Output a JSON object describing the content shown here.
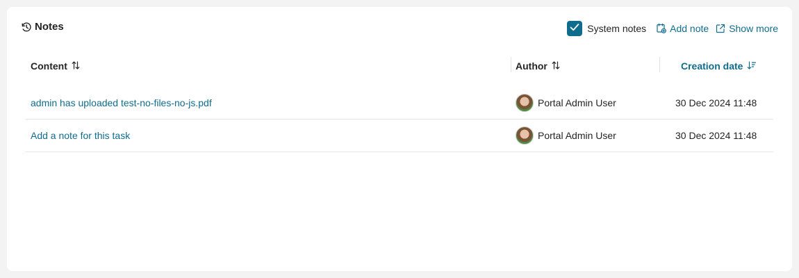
{
  "header": {
    "title": "Notes",
    "system_notes_label": "System notes",
    "system_notes_checked": true,
    "add_note_label": "Add note",
    "show_more_label": "Show more"
  },
  "table": {
    "columns": {
      "content": "Content",
      "author": "Author",
      "creation_date": "Creation date"
    },
    "sorted_by": "Creation date",
    "rows": [
      {
        "content": "admin has uploaded test-no-files-no-js.pdf",
        "author": "Portal Admin User",
        "date": "30 Dec 2024 11:48"
      },
      {
        "content": "Add a note for this task",
        "author": "Portal Admin User",
        "date": "30 Dec 2024 11:48"
      }
    ]
  },
  "colors": {
    "accent": "#0f6c8d",
    "text": "#242424",
    "background": "#f3f3f3",
    "card": "#ffffff"
  },
  "icons": {
    "title": "history-icon",
    "add_note": "note-add-icon",
    "show_more": "open-external-icon",
    "sort_neutral": "sort-arrows-icon",
    "sort_desc": "sort-descending-icon"
  }
}
